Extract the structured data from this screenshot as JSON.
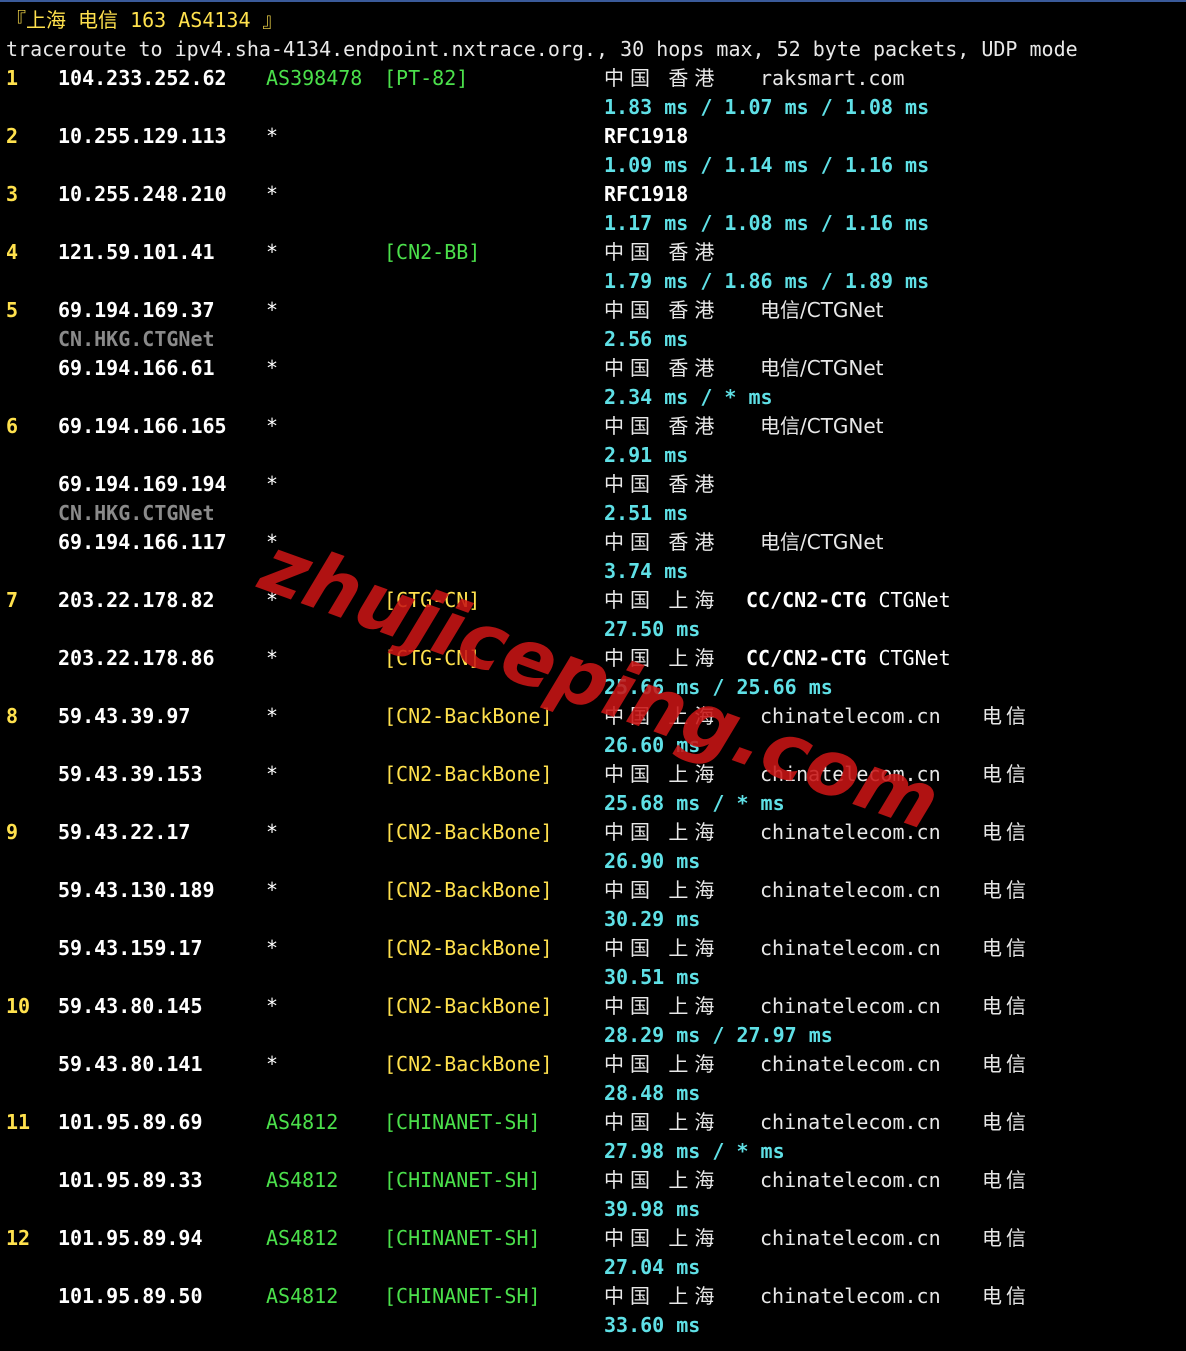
{
  "header": {
    "title": "『上海 电信 163 AS4134 』",
    "command": "traceroute to ipv4.sha-4134.endpoint.nxtrace.org., 30 hops max, 52 byte packets, UDP mode"
  },
  "hops": [
    {
      "hop": "1",
      "ip": "104.233.252.62",
      "as": "AS398478",
      "tag": "[PT-82]",
      "geo": "中国 香港",
      "org": "raksmart.com",
      "isp": "",
      "rtt": "1.83 ms / 1.07 ms / 1.08 ms"
    },
    {
      "hop": "2",
      "ip": "10.255.129.113",
      "as": "*",
      "tag": "",
      "geo": "RFC1918",
      "org": "",
      "isp": "",
      "rtt": "1.09 ms / 1.14 ms / 1.16 ms"
    },
    {
      "hop": "3",
      "ip": "10.255.248.210",
      "as": "*",
      "tag": "",
      "geo": "RFC1918",
      "org": "",
      "isp": "",
      "rtt": "1.17 ms / 1.08 ms / 1.16 ms"
    },
    {
      "hop": "4",
      "ip": "121.59.101.41",
      "as": "*",
      "tag": "[CN2-BB]",
      "geo": "中国 香港",
      "org": "",
      "isp": "",
      "rtt": "1.79 ms / 1.86 ms / 1.89 ms"
    },
    {
      "hop": "5",
      "ip": "69.194.169.37",
      "ptr": "CN.HKG.CTGNet",
      "as": "*",
      "tag": "",
      "geo": "中国 香港",
      "org": "电信/CTGNet",
      "isp": "",
      "rtt": "2.56 ms"
    },
    {
      "hop": "",
      "ip": "69.194.166.61",
      "as": "*",
      "tag": "",
      "geo": "中国 香港",
      "org": "电信/CTGNet",
      "isp": "",
      "rtt": "2.34 ms / * ms"
    },
    {
      "hop": "6",
      "ip": "69.194.166.165",
      "as": "*",
      "tag": "",
      "geo": "中国 香港",
      "org": "电信/CTGNet",
      "isp": "",
      "rtt": "2.91 ms"
    },
    {
      "hop": "",
      "ip": "69.194.169.194",
      "ptr": "CN.HKG.CTGNet",
      "as": "*",
      "tag": "",
      "geo": "中国 香港",
      "org": "",
      "isp": "",
      "rtt": "2.51 ms"
    },
    {
      "hop": "",
      "ip": "69.194.166.117",
      "as": "*",
      "tag": "",
      "geo": "中国 香港",
      "org": "电信/CTGNet",
      "isp": "",
      "rtt": "3.74 ms"
    },
    {
      "hop": "7",
      "ip": "203.22.178.82",
      "as": "*",
      "tag": "[CTG-CN]",
      "geo": "中国 上海",
      "org2": "CC/CN2-CTG CTGNet",
      "isp": "",
      "rtt": "27.50 ms"
    },
    {
      "hop": "",
      "ip": "203.22.178.86",
      "as": "*",
      "tag": "[CTG-CN]",
      "geo": "中国 上海",
      "org2": "CC/CN2-CTG CTGNet",
      "isp": "",
      "rtt": "25.66 ms / 25.66 ms"
    },
    {
      "hop": "8",
      "ip": "59.43.39.97",
      "as": "*",
      "tag": "[CN2-BackBone]",
      "geo": "中国 上海",
      "org": "chinatelecom.cn",
      "isp": "电信",
      "rtt": "26.60 ms"
    },
    {
      "hop": "",
      "ip": "59.43.39.153",
      "as": "*",
      "tag": "[CN2-BackBone]",
      "geo": "中国 上海",
      "org": "chinatelecom.cn",
      "isp": "电信",
      "rtt": "25.68 ms / * ms"
    },
    {
      "hop": "9",
      "ip": "59.43.22.17",
      "as": "*",
      "tag": "[CN2-BackBone]",
      "geo": "中国 上海",
      "org": "chinatelecom.cn",
      "isp": "电信",
      "rtt": "26.90 ms"
    },
    {
      "hop": "",
      "ip": "59.43.130.189",
      "as": "*",
      "tag": "[CN2-BackBone]",
      "geo": "中国 上海",
      "org": "chinatelecom.cn",
      "isp": "电信",
      "rtt": "30.29 ms"
    },
    {
      "hop": "",
      "ip": "59.43.159.17",
      "as": "*",
      "tag": "[CN2-BackBone]",
      "geo": "中国 上海",
      "org": "chinatelecom.cn",
      "isp": "电信",
      "rtt": "30.51 ms"
    },
    {
      "hop": "10",
      "ip": "59.43.80.145",
      "as": "*",
      "tag": "[CN2-BackBone]",
      "geo": "中国 上海",
      "org": "chinatelecom.cn",
      "isp": "电信",
      "rtt": "28.29 ms / 27.97 ms"
    },
    {
      "hop": "",
      "ip": "59.43.80.141",
      "as": "*",
      "tag": "[CN2-BackBone]",
      "geo": "中国 上海",
      "org": "chinatelecom.cn",
      "isp": "电信",
      "rtt": "28.48 ms"
    },
    {
      "hop": "11",
      "ip": "101.95.89.69",
      "as": "AS4812",
      "tag": "[CHINANET-SH]",
      "geo": "中国 上海",
      "org": "chinatelecom.cn",
      "isp": "电信",
      "rtt": "27.98 ms / * ms"
    },
    {
      "hop": "",
      "ip": "101.95.89.33",
      "as": "AS4812",
      "tag": "[CHINANET-SH]",
      "geo": "中国 上海",
      "org": "chinatelecom.cn",
      "isp": "电信",
      "rtt": "39.98 ms"
    },
    {
      "hop": "12",
      "ip": "101.95.89.94",
      "as": "AS4812",
      "tag": "[CHINANET-SH]",
      "geo": "中国 上海",
      "org": "chinatelecom.cn",
      "isp": "电信",
      "rtt": "27.04 ms"
    },
    {
      "hop": "",
      "ip": "101.95.89.50",
      "as": "AS4812",
      "tag": "[CHINANET-SH]",
      "geo": "中国 上海",
      "org": "chinatelecom.cn",
      "isp": "电信",
      "rtt": "33.60 ms"
    }
  ],
  "watermark": "zhujiceping.com",
  "colors": {
    "background": "#000000",
    "hop_number": "#ffe14d",
    "as_green": "#4be04b",
    "tag_yellow": "#ffe14d",
    "rtt_cyan": "#5fe0e6",
    "ptr_gray": "#8a8a8a",
    "watermark_red": "#c81414"
  }
}
